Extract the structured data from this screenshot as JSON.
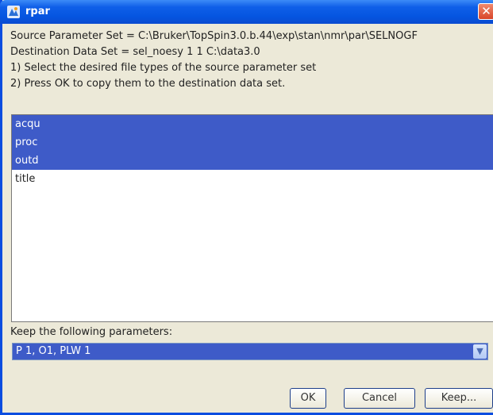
{
  "window": {
    "title": "rpar",
    "close_symbol": "✕"
  },
  "info": {
    "line1": "Source Parameter Set = C:\\Bruker\\TopSpin3.0.b.44\\exp\\stan\\nmr\\par\\SELNOGF",
    "line2": "Destination Data Set = sel_noesy  1  1  C:\\data3.0",
    "line3": "1) Select the desired file types of the source parameter set",
    "line4": "2) Press OK to copy them to the destination data set."
  },
  "file_types": [
    {
      "label": "acqu",
      "selected": true
    },
    {
      "label": "proc",
      "selected": true
    },
    {
      "label": "outd",
      "selected": true
    },
    {
      "label": "title",
      "selected": false
    }
  ],
  "keep": {
    "label": "Keep the following parameters:",
    "selected_value": "P 1, O1, PLW 1"
  },
  "buttons": {
    "ok": "OK",
    "cancel": "Cancel",
    "keep": "Keep..."
  },
  "icons": {
    "app": "topspin-app-icon",
    "dropdown": "chevron-down-icon"
  },
  "colors": {
    "titlebar": "#0555e0",
    "selection": "#3e5bc8",
    "dialog_bg": "#ece9d8"
  }
}
